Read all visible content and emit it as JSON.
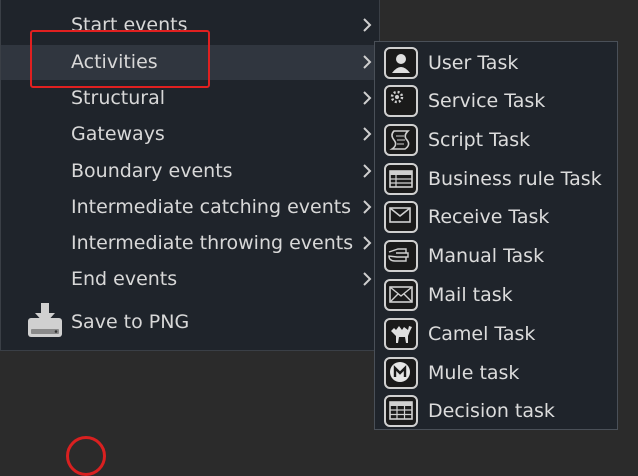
{
  "menu": {
    "items": [
      {
        "label": "Start events"
      },
      {
        "label": "Activities"
      },
      {
        "label": "Structural"
      },
      {
        "label": "Gateways"
      },
      {
        "label": "Boundary events"
      },
      {
        "label": "Intermediate catching events"
      },
      {
        "label": "Intermediate throwing events"
      },
      {
        "label": "End events"
      }
    ],
    "save_label": "Save to PNG",
    "active_item": "Activities"
  },
  "submenu": {
    "items": [
      {
        "label": "User Task",
        "icon": "user-task-icon"
      },
      {
        "label": "Service Task",
        "icon": "service-task-icon"
      },
      {
        "label": "Script Task",
        "icon": "script-task-icon"
      },
      {
        "label": "Business rule Task",
        "icon": "business-rule-task-icon"
      },
      {
        "label": "Receive Task",
        "icon": "receive-task-icon"
      },
      {
        "label": "Manual Task",
        "icon": "manual-task-icon"
      },
      {
        "label": "Mail task",
        "icon": "mail-task-icon"
      },
      {
        "label": "Camel Task",
        "icon": "camel-task-icon"
      },
      {
        "label": "Mule task",
        "icon": "mule-task-icon"
      },
      {
        "label": "Decision task",
        "icon": "decision-task-icon"
      }
    ]
  },
  "colors": {
    "menu_bg": "#1f242b",
    "active_bg": "#30363f",
    "highlight": "#e02020",
    "text": "#d8d8d8"
  }
}
